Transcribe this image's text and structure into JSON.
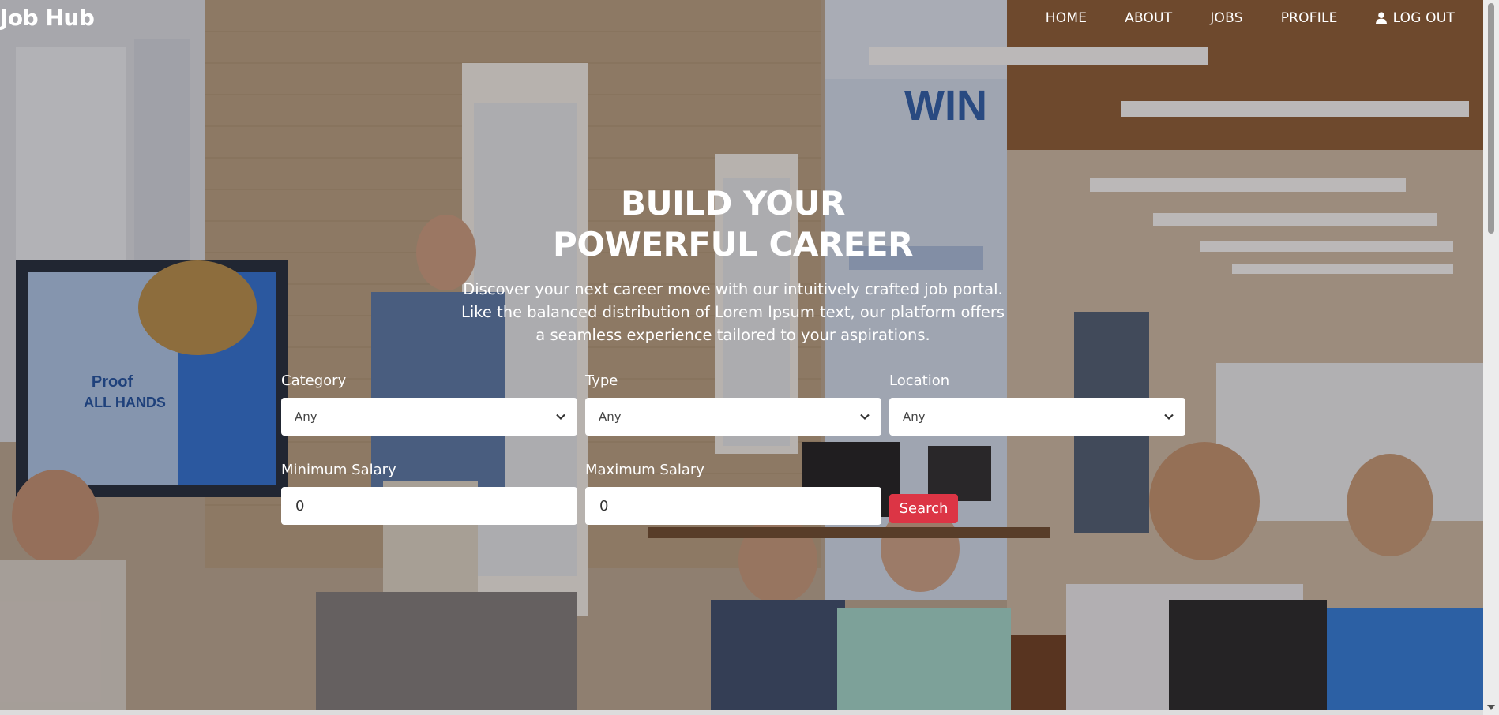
{
  "brand": "Job Hub",
  "nav": {
    "home": "HOME",
    "about": "ABOUT",
    "jobs": "JOBS",
    "profile": "PROFILE",
    "logout": "LOG OUT"
  },
  "hero": {
    "title_line1": "BUILD YOUR",
    "title_line2": "POWERFUL CAREER",
    "desc_line1": "Discover your next career move with our intuitively crafted job portal.",
    "desc_line2": "Like the balanced distribution of Lorem Ipsum text, our platform offers",
    "desc_line3": "a seamless experience tailored to your aspirations."
  },
  "form": {
    "category": {
      "label": "Category",
      "value": "Any"
    },
    "type": {
      "label": "Type",
      "value": "Any"
    },
    "location": {
      "label": "Location",
      "value": "Any"
    },
    "min_salary": {
      "label": "Minimum Salary",
      "value": "0"
    },
    "max_salary": {
      "label": "Maximum Salary",
      "value": "0"
    },
    "search_label": "Search"
  },
  "colors": {
    "accent": "#dc3545",
    "text": "#ffffff"
  }
}
